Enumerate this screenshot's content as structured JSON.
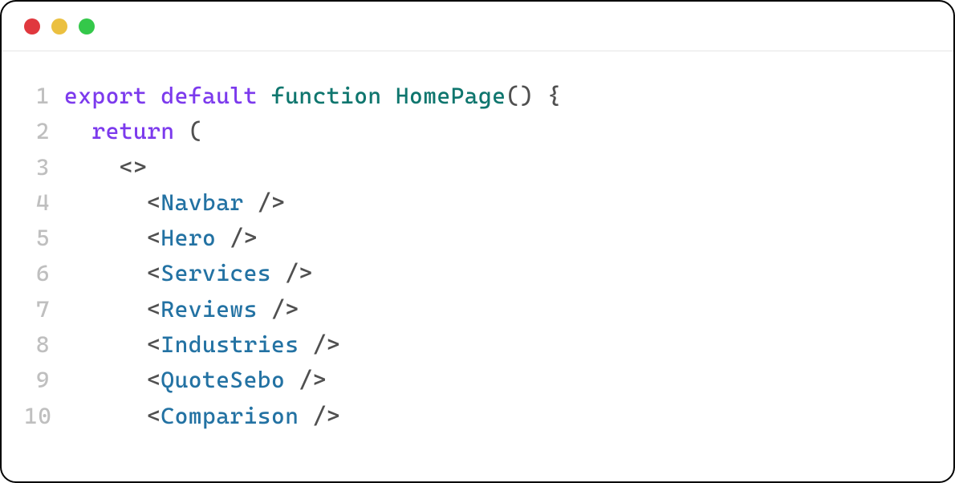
{
  "titlebar": {
    "dots": [
      "red",
      "yellow",
      "green"
    ]
  },
  "code": {
    "lines": [
      {
        "n": "1",
        "tokens": [
          {
            "cls": "kw",
            "t": "export"
          },
          {
            "cls": "",
            "t": " "
          },
          {
            "cls": "kw",
            "t": "default"
          },
          {
            "cls": "",
            "t": " "
          },
          {
            "cls": "fn",
            "t": "function"
          },
          {
            "cls": "",
            "t": " "
          },
          {
            "cls": "fn",
            "t": "HomePage"
          },
          {
            "cls": "punct",
            "t": "()"
          },
          {
            "cls": "",
            "t": " "
          },
          {
            "cls": "punct",
            "t": "{"
          }
        ]
      },
      {
        "n": "2",
        "tokens": [
          {
            "cls": "",
            "t": "  "
          },
          {
            "cls": "kw",
            "t": "return"
          },
          {
            "cls": "",
            "t": " "
          },
          {
            "cls": "punct",
            "t": "("
          }
        ]
      },
      {
        "n": "3",
        "tokens": [
          {
            "cls": "",
            "t": "    "
          },
          {
            "cls": "punct",
            "t": "<>"
          }
        ]
      },
      {
        "n": "4",
        "tokens": [
          {
            "cls": "",
            "t": "      "
          },
          {
            "cls": "punct",
            "t": "<"
          },
          {
            "cls": "comp",
            "t": "Navbar"
          },
          {
            "cls": "",
            "t": " "
          },
          {
            "cls": "slash",
            "t": "/>"
          }
        ]
      },
      {
        "n": "5",
        "tokens": [
          {
            "cls": "",
            "t": "      "
          },
          {
            "cls": "punct",
            "t": "<"
          },
          {
            "cls": "comp",
            "t": "Hero"
          },
          {
            "cls": "",
            "t": " "
          },
          {
            "cls": "slash",
            "t": "/>"
          }
        ]
      },
      {
        "n": "6",
        "tokens": [
          {
            "cls": "",
            "t": "      "
          },
          {
            "cls": "punct",
            "t": "<"
          },
          {
            "cls": "comp",
            "t": "Services"
          },
          {
            "cls": "",
            "t": " "
          },
          {
            "cls": "slash",
            "t": "/>"
          }
        ]
      },
      {
        "n": "7",
        "tokens": [
          {
            "cls": "",
            "t": "      "
          },
          {
            "cls": "punct",
            "t": "<"
          },
          {
            "cls": "comp",
            "t": "Reviews"
          },
          {
            "cls": "",
            "t": " "
          },
          {
            "cls": "slash",
            "t": "/>"
          }
        ]
      },
      {
        "n": "8",
        "tokens": [
          {
            "cls": "",
            "t": "      "
          },
          {
            "cls": "punct",
            "t": "<"
          },
          {
            "cls": "comp",
            "t": "Industries"
          },
          {
            "cls": "",
            "t": " "
          },
          {
            "cls": "slash",
            "t": "/>"
          }
        ]
      },
      {
        "n": "9",
        "tokens": [
          {
            "cls": "",
            "t": "      "
          },
          {
            "cls": "punct",
            "t": "<"
          },
          {
            "cls": "comp",
            "t": "QuoteSebo"
          },
          {
            "cls": "",
            "t": " "
          },
          {
            "cls": "slash",
            "t": "/>"
          }
        ]
      },
      {
        "n": "10",
        "tokens": [
          {
            "cls": "",
            "t": "      "
          },
          {
            "cls": "punct",
            "t": "<"
          },
          {
            "cls": "comp",
            "t": "Comparison"
          },
          {
            "cls": "",
            "t": " "
          },
          {
            "cls": "slash",
            "t": "/>"
          }
        ]
      }
    ]
  }
}
